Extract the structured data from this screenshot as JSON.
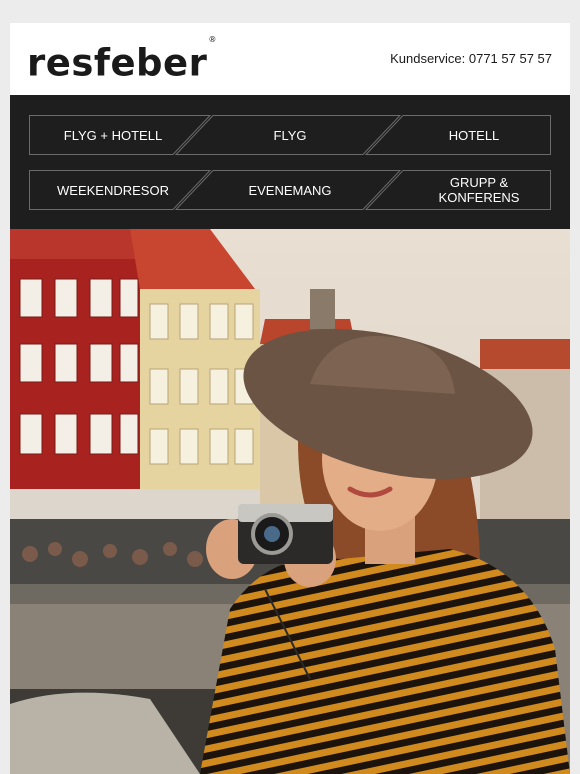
{
  "brand": {
    "logo_text": "resfeber",
    "registered_mark": "®"
  },
  "header": {
    "customer_service_label": "Kundservice:",
    "customer_service_phone": "0771 57 57 57"
  },
  "nav": {
    "row1": [
      "FLYG + HOTELL",
      "FLYG",
      "HOTELL"
    ],
    "row2": [
      "WEEKENDRESOR",
      "EVENEMANG",
      "GRUPP & KONFERENS"
    ]
  },
  "hero": {
    "image": "woman-with-camera-in-nyhavn-photo"
  },
  "colors": {
    "nav_bg": "#1e1e1e",
    "accent_stripe": "#d08a1e",
    "text_dark": "#1a1a1a"
  }
}
